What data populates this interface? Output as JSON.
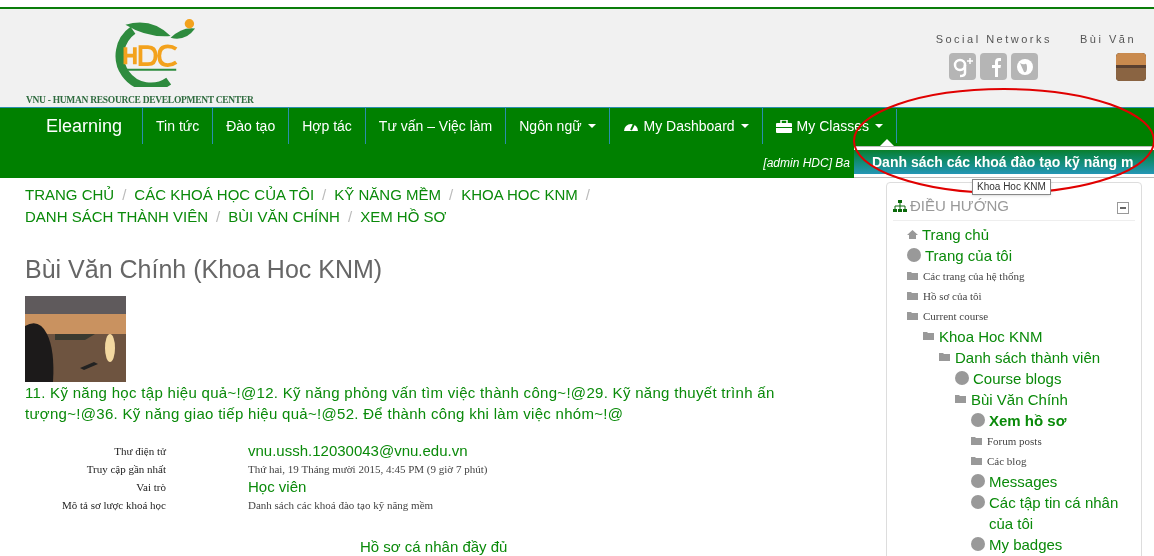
{
  "header": {
    "logo_caption": "VNU - HUMAN RESOURCE DEVELOPMENT CENTER",
    "social_label": "Social Networks",
    "social_icons": [
      {
        "kind": "google"
      },
      {
        "kind": "facebook"
      },
      {
        "kind": "globe"
      }
    ],
    "user_name": "Bùi Văn"
  },
  "nav": {
    "items": [
      {
        "label": "Elearning",
        "kind": "brand",
        "dropdown": false
      },
      {
        "label": "Tin tức",
        "kind": "plain",
        "dropdown": false
      },
      {
        "label": "Đào tạo",
        "kind": "plain",
        "dropdown": false
      },
      {
        "label": "Hợp tác",
        "kind": "plain",
        "dropdown": false
      },
      {
        "label": "Tư vấn – Việc làm",
        "kind": "plain",
        "dropdown": false
      },
      {
        "label": "Ngôn ngữ",
        "kind": "plain",
        "dropdown": true
      },
      {
        "label": "My Dashboard",
        "kind": "dashboard",
        "dropdown": true
      },
      {
        "label": "My Classes",
        "kind": "classes",
        "dropdown": true
      }
    ],
    "user_line": "[admin HDC] Ba",
    "dropdown_item": "Danh sách các khoá đào tạo kỹ năng m",
    "tooltip": "Khoa Hoc KNM"
  },
  "breadcrumb_separator": "/",
  "breadcrumbs": [
    "TRANG CHỦ",
    "CÁC KHOÁ HỌC CỦA TÔI",
    "KỸ NĂNG MỀM",
    "KHOA HOC KNM",
    "DANH SÁCH THÀNH VIÊN",
    "BÙI VĂN CHÍNH",
    "XEM HỒ SƠ"
  ],
  "profile": {
    "title": "Bùi Văn Chính (Khoa Hoc KNM)",
    "courses": "11. Kỹ năng học tập hiệu quả~!@12. Kỹ năng phỏng vấn tìm việc thành công~!@29. Kỹ năng thuyết trình ấn tượng~!@36. Kỹ năng giao tiếp hiệu quả~!@52. Để thành công khi làm việc nhóm~!@",
    "fields": [
      {
        "label": "Thư điện tử",
        "value": "vnu.ussh.12030043@vnu.edu.vn",
        "kind": "link"
      },
      {
        "label": "Truy cập gần nhất",
        "value": "Thứ hai, 19 Tháng mười 2015, 4:45 PM  (9 giờ 7 phút)",
        "kind": "text"
      },
      {
        "label": "Vai trò",
        "value": "Học viên",
        "kind": "link"
      },
      {
        "label": "Mô tả sơ lược khoá học",
        "value": "Danh sách các khoá đào tạo kỹ năng mềm",
        "kind": "text"
      }
    ],
    "full_profile_link": "Hồ sơ cá nhân đầy đủ"
  },
  "navigation_block": {
    "title": "ĐIỀU HƯỚNG",
    "items": [
      {
        "label": "Trang chủ",
        "kind": "home",
        "link": true,
        "selected": false
      },
      {
        "label": "Trang của tôi",
        "kind": "circle",
        "link": true,
        "selected": false
      },
      {
        "label": "Các trang của hệ thống",
        "kind": "folder",
        "link": false,
        "selected": false
      },
      {
        "label": "Hồ sơ của tôi",
        "kind": "folder",
        "link": false,
        "selected": false
      },
      {
        "label": "Current course",
        "kind": "folder",
        "link": false,
        "selected": false,
        "children": [
          {
            "label": "Khoa Hoc KNM",
            "kind": "folder",
            "link": true,
            "selected": false,
            "children": [
              {
                "label": "Danh sách thành viên",
                "kind": "folder",
                "link": true,
                "selected": false,
                "children": [
                  {
                    "label": "Course blogs",
                    "kind": "circle",
                    "link": true,
                    "selected": false
                  },
                  {
                    "label": "Bùi Văn Chính",
                    "kind": "folder",
                    "link": true,
                    "selected": false,
                    "children": [
                      {
                        "label": "Xem hồ sơ",
                        "kind": "circle",
                        "link": true,
                        "selected": true
                      },
                      {
                        "label": "Forum posts",
                        "kind": "folder",
                        "link": false,
                        "selected": false
                      },
                      {
                        "label": "Các blog",
                        "kind": "folder",
                        "link": false,
                        "selected": false
                      },
                      {
                        "label": "Messages",
                        "kind": "circle",
                        "link": true,
                        "selected": false
                      },
                      {
                        "label": "Các tập tin cá nhân của tôi",
                        "kind": "circle",
                        "link": true,
                        "selected": false
                      },
                      {
                        "label": "My badges",
                        "kind": "circle",
                        "link": true,
                        "selected": false
                      }
                    ]
                  }
                ]
              }
            ]
          }
        ]
      }
    ]
  }
}
